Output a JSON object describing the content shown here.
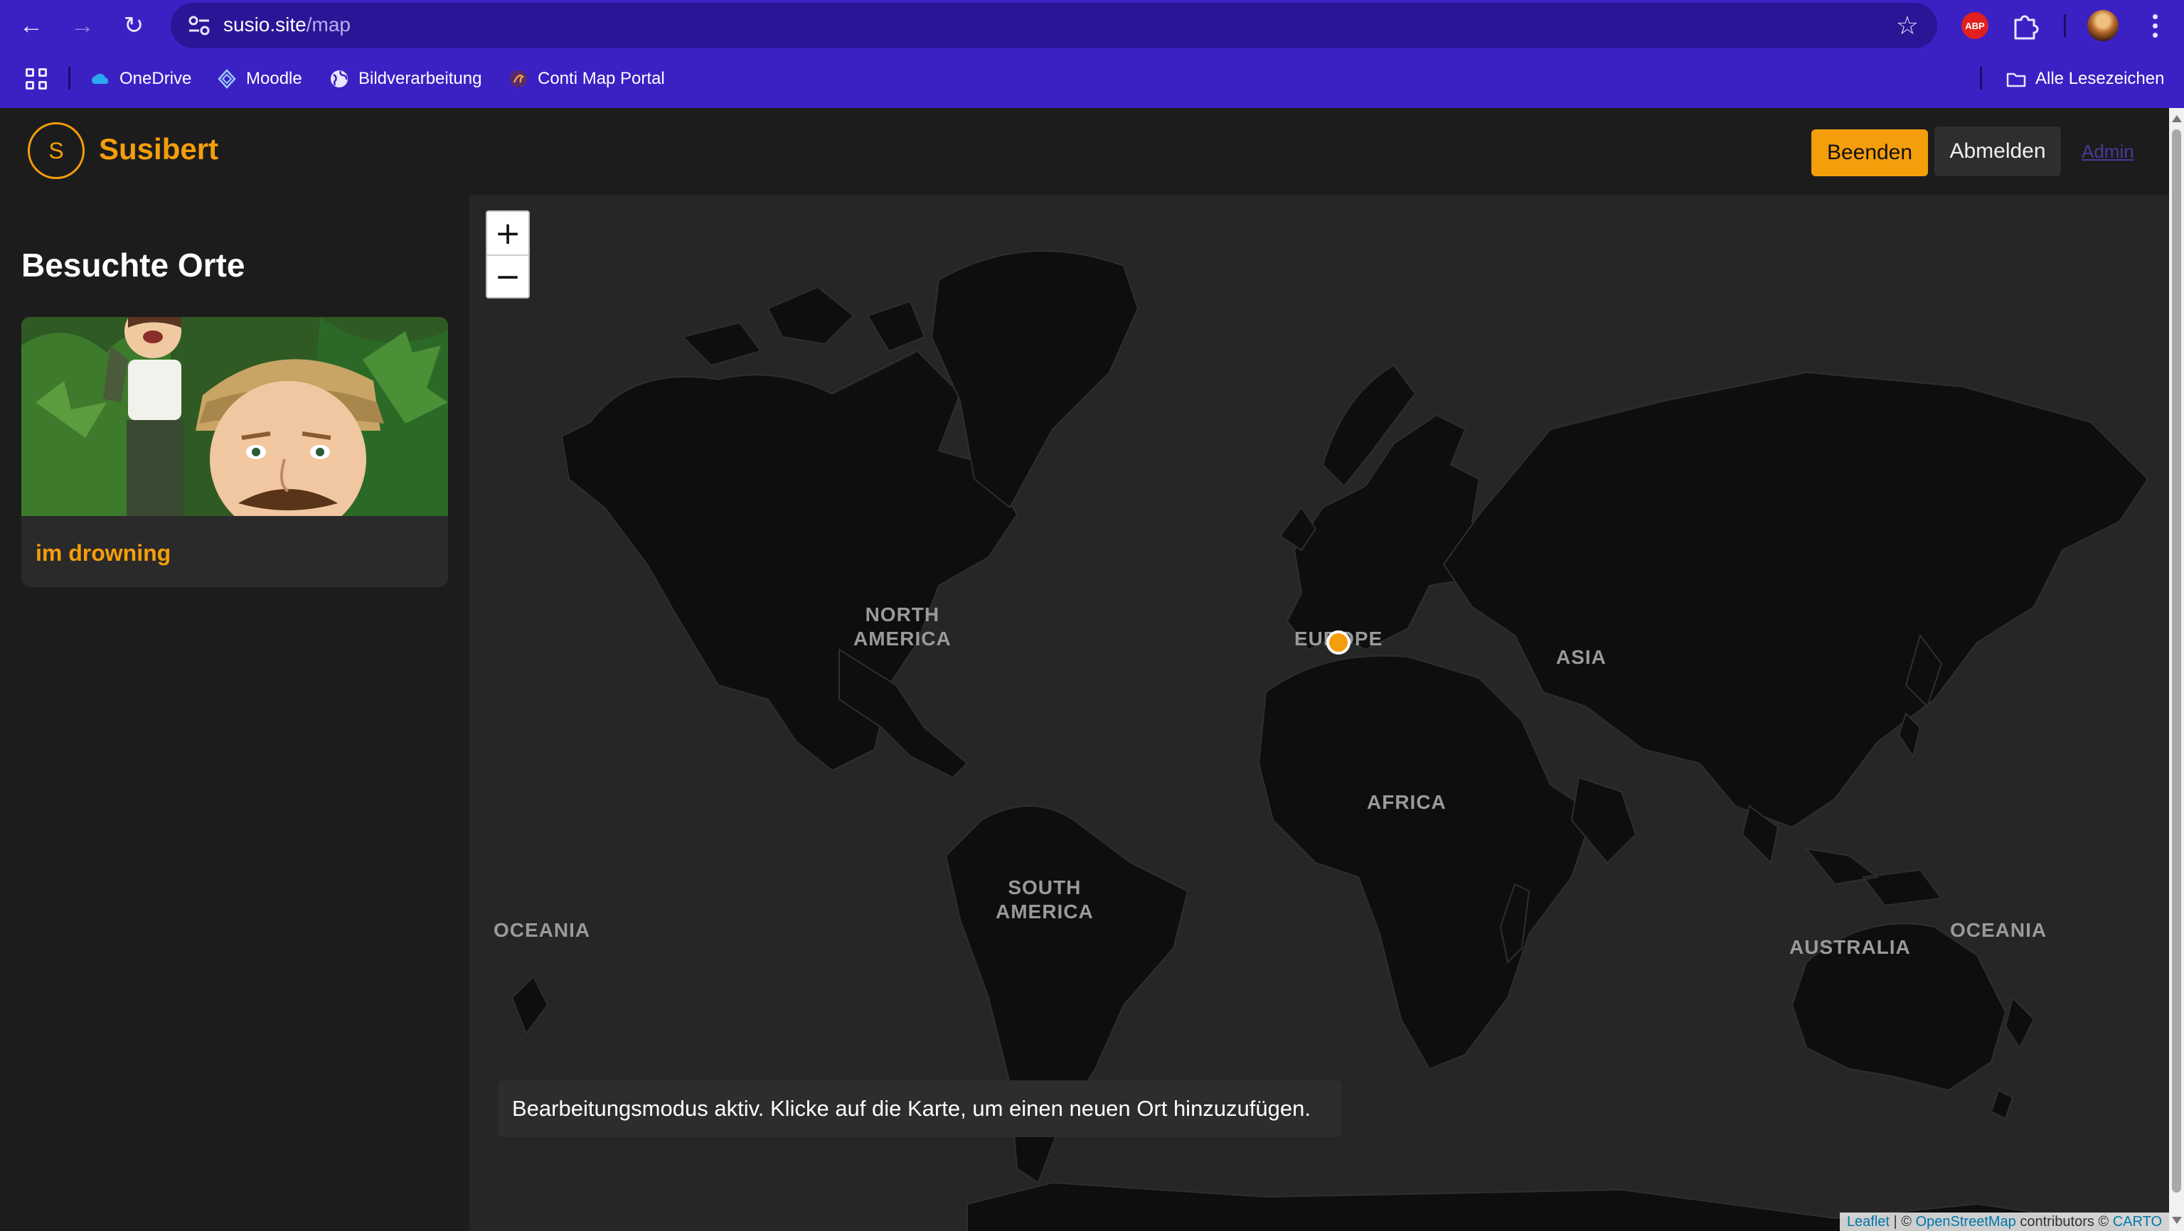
{
  "browser": {
    "url_host": "susio.site",
    "url_path": "/map",
    "bookmarks": [
      {
        "label": "OneDrive",
        "icon": "onedrive-icon"
      },
      {
        "label": "Moodle",
        "icon": "moodle-icon"
      },
      {
        "label": "Bildverarbeitung",
        "icon": "globe-icon"
      },
      {
        "label": "Conti Map Portal",
        "icon": "conti-icon"
      }
    ],
    "all_bookmarks": "Alle Lesezeichen",
    "abp_label": "ABP"
  },
  "app": {
    "logo_letter": "S",
    "brand": "Susibert",
    "buttons": {
      "finish": "Beenden",
      "logout": "Abmelden",
      "admin": "Admin"
    },
    "accent": "#f59e0b"
  },
  "sidebar": {
    "title": "Besuchte Orte",
    "places": [
      {
        "title": "im drowning"
      }
    ]
  },
  "map": {
    "zoom_in": "+",
    "zoom_out": "−",
    "labels": {
      "north_america": "NORTH\nAMERICA",
      "south_america": "SOUTH\nAMERICA",
      "europe": "EUROPE",
      "africa": "AFRICA",
      "asia": "ASIA",
      "australia": "AUSTRALIA",
      "oceania": "OCEANIA"
    },
    "notice": "Bearbeitungsmodus aktiv. Klicke auf die Karte, um einen neuen Ort hinzuzufügen.",
    "attribution": {
      "leaflet": "Leaflet",
      "sep": " | © ",
      "osm": "OpenStreetMap",
      "mid": " contributors © ",
      "carto": "CARTO"
    }
  }
}
